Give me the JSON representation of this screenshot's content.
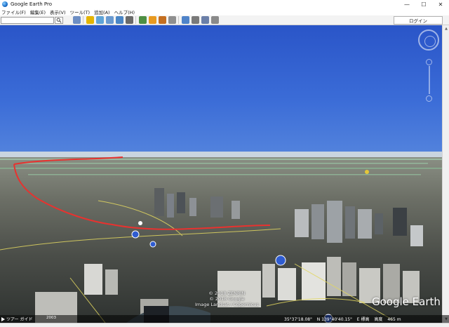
{
  "window": {
    "title": "Google Earth Pro",
    "minimize": "—",
    "maximize": "☐",
    "close": "✕"
  },
  "menu": {
    "items": [
      {
        "label": "ファイル(F)"
      },
      {
        "label": "編集(E)"
      },
      {
        "label": "表示(V)"
      },
      {
        "label": "ツール(T)"
      },
      {
        "label": "追加(A)"
      },
      {
        "label": "ヘルプ(H)"
      }
    ]
  },
  "toolbar": {
    "search_value": "",
    "login_label": "ログイン",
    "icons": [
      {
        "name": "sidebar-toggle-icon",
        "color": "#6d8ec4"
      },
      {
        "name": "placemark-icon",
        "color": "#e4b400"
      },
      {
        "name": "polygon-icon",
        "color": "#5fa4d8"
      },
      {
        "name": "path-icon",
        "color": "#6a9ad0"
      },
      {
        "name": "overlay-icon",
        "color": "#4a86c6"
      },
      {
        "name": "tour-record-icon",
        "color": "#6a6a6a"
      },
      {
        "name": "historical-imagery-icon",
        "color": "#4d8f43"
      },
      {
        "name": "sunlight-icon",
        "color": "#e89a20"
      },
      {
        "name": "planets-icon",
        "color": "#c46f20"
      },
      {
        "name": "ruler-icon",
        "color": "#8f8f8f"
      },
      {
        "name": "email-icon",
        "color": "#4f83c9"
      },
      {
        "name": "print-icon",
        "color": "#7a7a7a"
      },
      {
        "name": "save-image-icon",
        "color": "#6b7fa8"
      },
      {
        "name": "view-maps-icon",
        "color": "#8a8a8a"
      }
    ]
  },
  "viewport": {
    "copyright_line1": "© 2018 ZENRIN",
    "copyright_line2": "© 2018 Google",
    "copyright_line3": "Image Landsat / Copernicus",
    "logo": "Google Earth",
    "route_color": "#e8322f"
  },
  "status": {
    "tour_label": "ツアー ガイド",
    "imagery_date": "2003",
    "lat": "35°37'18.08\"",
    "lon": "N  139°40'40.15\"",
    "elev_label": "E  標高",
    "alt": "高度",
    "alt_value": "465 m"
  }
}
